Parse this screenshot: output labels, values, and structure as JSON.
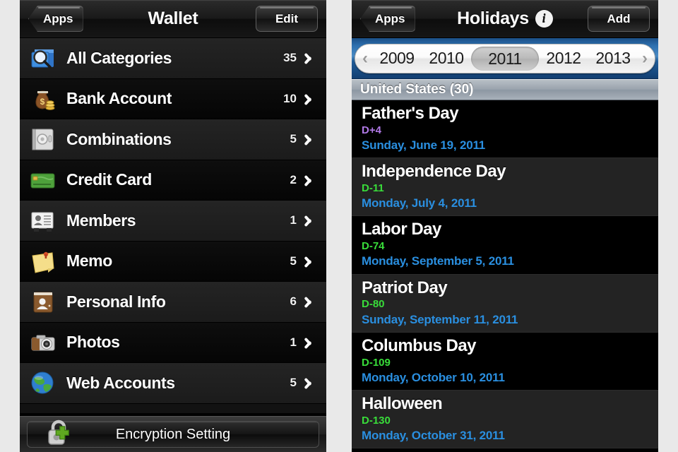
{
  "colors": {
    "accent_blue": "#2a8fe0",
    "dday_green": "#39dd3a",
    "dday_purple": "#b27ae8",
    "gap_background": "#e9e9e9"
  },
  "wallet": {
    "nav": {
      "back_label": "Apps",
      "title": "Wallet",
      "action_label": "Edit",
      "back_icon": "chevron-left-icon"
    },
    "categories": [
      {
        "icon": "search-folder-icon",
        "label": "All Categories",
        "count": "35"
      },
      {
        "icon": "money-bag-icon",
        "label": "Bank Account",
        "count": "10"
      },
      {
        "icon": "safe-icon",
        "label": "Combinations",
        "count": "5"
      },
      {
        "icon": "credit-card-icon",
        "label": "Credit Card",
        "count": "2"
      },
      {
        "icon": "id-card-icon",
        "label": "Members",
        "count": "1"
      },
      {
        "icon": "sticky-note-icon",
        "label": "Memo",
        "count": "5"
      },
      {
        "icon": "address-book-icon",
        "label": "Personal Info",
        "count": "6"
      },
      {
        "icon": "camera-icon",
        "label": "Photos",
        "count": "1"
      },
      {
        "icon": "globe-icon",
        "label": "Web Accounts",
        "count": "5"
      }
    ],
    "toolbar": {
      "encryption_label": "Encryption Setting",
      "encryption_icon": "lock-plus-icon"
    }
  },
  "holidays": {
    "nav": {
      "back_label": "Apps",
      "title": "Holidays",
      "info_icon": "info-circle-icon",
      "action_label": "Add",
      "back_icon": "chevron-left-icon"
    },
    "year_picker": {
      "prev_icon": "chevron-left-icon",
      "next_icon": "chevron-right-icon",
      "years": [
        "2009",
        "2010",
        "2011",
        "2012",
        "2013"
      ],
      "selected": "2011"
    },
    "section_header": "United States (30)",
    "items": [
      {
        "name": "Father's Day",
        "dday": "D+4",
        "dday_kind": "future",
        "date": "Sunday, June 19, 2011"
      },
      {
        "name": "Independence Day",
        "dday": "D-11",
        "dday_kind": "past",
        "date": "Monday, July 4, 2011"
      },
      {
        "name": "Labor Day",
        "dday": "D-74",
        "dday_kind": "past",
        "date": "Monday, September 5, 2011"
      },
      {
        "name": "Patriot Day",
        "dday": "D-80",
        "dday_kind": "past",
        "date": "Sunday, September 11, 2011"
      },
      {
        "name": "Columbus Day",
        "dday": "D-109",
        "dday_kind": "past",
        "date": "Monday, October 10, 2011"
      },
      {
        "name": "Halloween",
        "dday": "D-130",
        "dday_kind": "past",
        "date": "Monday, October 31, 2011"
      }
    ]
  }
}
